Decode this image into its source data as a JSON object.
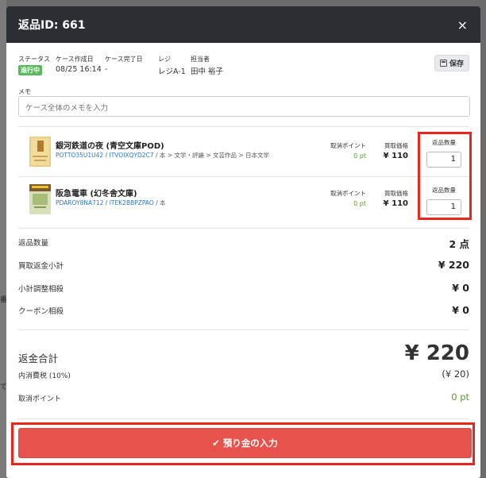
{
  "modal": {
    "title": "返品ID: 661",
    "close_glyph": "×"
  },
  "case": {
    "status_label": "ステータス",
    "status_value": "進行中",
    "created_label": "ケース作成日",
    "created_value": "08/25 16:14",
    "completed_label": "ケース完了日",
    "completed_value": "-",
    "register_label": "レジ",
    "register_value": "レジA-1",
    "staff_label": "担当者",
    "staff_value": "田中 裕子",
    "save_label": "保存"
  },
  "memo": {
    "label": "メモ",
    "placeholder": "ケース全体のメモを入力"
  },
  "items": [
    {
      "title": "銀河鉄道の夜 (青空文庫POD)",
      "code1": "POTTO35U1U42",
      "code2": "ITVOIXQYD2C7",
      "path": " / 本 > 文学・評論 > 文芸作品 > 日本文学",
      "cancel_points_label": "取消ポイント",
      "cancel_points_value": "0 pt",
      "buy_price_label": "買取価格",
      "buy_price_value": "¥ 110",
      "qty_label": "返品数量",
      "qty_value": "1"
    },
    {
      "title": "阪急電車 (幻冬舎文庫)",
      "code1": "PDAROY8NA712",
      "code2": "ITEK2BBPZPAO",
      "path": " / 本",
      "cancel_points_label": "取消ポイント",
      "cancel_points_value": "0 pt",
      "buy_price_label": "買取価格",
      "buy_price_value": "¥ 110",
      "qty_label": "返品数量",
      "qty_value": "1"
    }
  ],
  "summary": {
    "qty_label": "返品数量",
    "qty_value": "2 点",
    "subtotal_label": "買取返金小計",
    "subtotal_value": "¥ 220",
    "adjust_label": "小計調整相殺",
    "adjust_value": "¥ 0",
    "coupon_label": "クーポン相殺",
    "coupon_value": "¥ 0",
    "total_label": "返金合計",
    "total_value": "¥ 220",
    "tax_label": "内消費税 (10%)",
    "tax_value": "(¥ 20)",
    "points_label": "取消ポイント",
    "points_value": "0 pt"
  },
  "deposit_button": {
    "check_glyph": "✔",
    "label": "預り金の入力"
  },
  "background": {
    "side_char_1": "番",
    "side_char_2": "て"
  },
  "colors": {
    "header_bg": "#2b2e33",
    "status_green": "#5cb85c",
    "link_blue": "#2a7ac0",
    "points_green": "#5a9a2f",
    "deposit_red": "#e8524d",
    "highlight_red": "#e8261d"
  }
}
